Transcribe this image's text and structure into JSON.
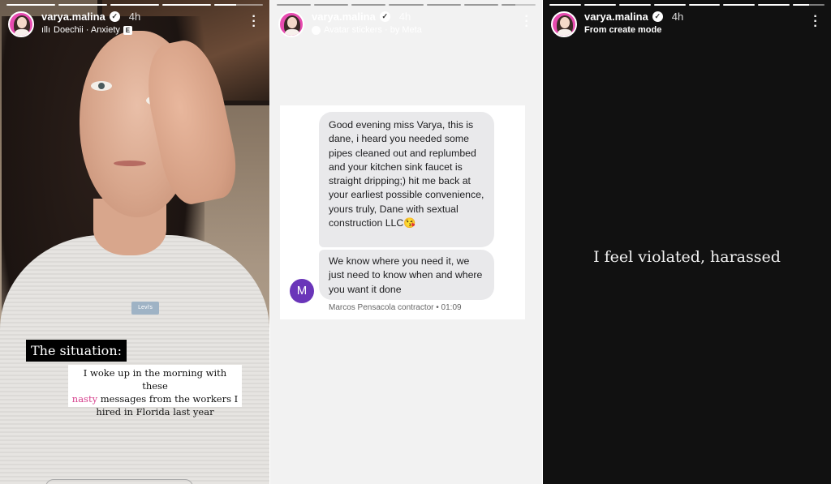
{
  "stories": [
    {
      "progress": [
        1,
        1,
        1,
        1,
        0.45
      ],
      "username": "varya.malina",
      "time": "4h",
      "subtitle": "Doechii · Anxiety",
      "subtitle_badge": "E",
      "overlay_label": "The situation:",
      "caption_before": "I woke up in the morning with these",
      "caption_highlight": "nasty",
      "caption_after": "messages from the workers I hired in Florida last year",
      "highlight_color": "#d63f8c"
    },
    {
      "progress": [
        1,
        1,
        1,
        1,
        1,
        1,
        0.4
      ],
      "username": "varya.malina",
      "time": "4h",
      "subtitle": "Avatar stickers · by Meta",
      "messages": [
        {
          "text": "Good evening miss Varya, this is dane, i heard you needed some pipes cleaned out and replumbed and your kitchen sink faucet is straight dripping;) hit me back at your earliest possible convenience, yours truly, Dane with sextual construction LLC😘"
        },
        {
          "text": "We know where you need it, we just need to know when and where you want it done"
        }
      ],
      "sender_initial": "M",
      "sender_color": "#6a35b9",
      "sender_meta": "Marcos Pensacola contractor • 01:09"
    },
    {
      "progress": [
        1,
        1,
        1,
        1,
        1,
        1,
        1,
        0.5
      ],
      "username": "varya.malina",
      "time": "4h",
      "subtitle": "From create mode",
      "text": "I feel violated, harassed"
    }
  ],
  "icons": {
    "verified": "verified-badge-icon",
    "more": "more-options-icon",
    "music": "music-icon",
    "sticker": "avatar-sticker-icon"
  }
}
